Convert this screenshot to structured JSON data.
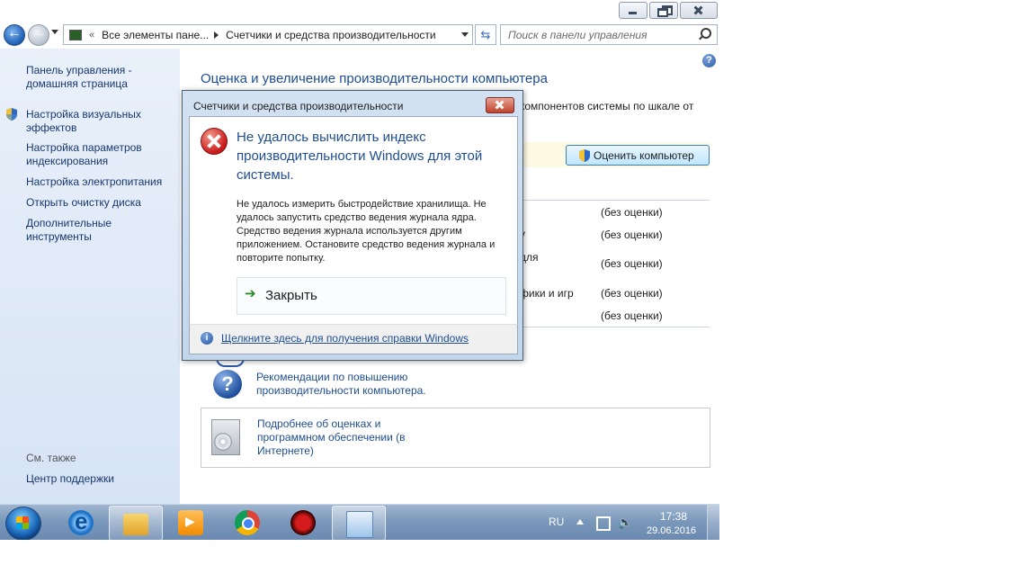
{
  "address": {
    "chevron": "«",
    "part1": "Все элементы пане...",
    "part2": "Счетчики и средства производительности"
  },
  "search": {
    "placeholder": "Поиск в панели управления"
  },
  "sidebar": {
    "items": [
      {
        "label": "Панель управления - домашняя страница"
      },
      {
        "label": "Настройка визуальных эффектов"
      },
      {
        "label": "Настройка параметров индексирования"
      },
      {
        "label": "Настройка электропитания"
      },
      {
        "label": "Открыть очистку диска"
      },
      {
        "label": "Дополнительные инструменты"
      }
    ],
    "see_also": "См. также",
    "support": "Центр поддержки"
  },
  "main": {
    "title": "Оценка и увеличение производительности компьютера",
    "bg_description": "компонентов системы по шкале от",
    "rate_button": "Оценить компьютер",
    "fragments": [
      "у",
      "для",
      "фики и игр"
    ],
    "scores": [
      "(без оценки)",
      "(без оценки)",
      "(без оценки)",
      "(без оценки)",
      "(без оценки)"
    ],
    "recommendations": "Рекомендации по повышению производительности компьютера.",
    "details": "Подробнее об оценках и программном обеспечении (в Интернете)"
  },
  "dialog": {
    "title": "Счетчики и средства производительности",
    "heading": "Не удалось вычислить индекс производительности Windows для этой системы.",
    "message": "Не удалось измерить быстродействие хранилища. Не удалось запустить средство ведения журнала ядра. Средство ведения журнала используется другим приложением. Остановите средство ведения журнала и повторите попытку.",
    "close_label": "Закрыть",
    "help_link": "Щелкните здесь для получения справки Windows"
  },
  "taskbar": {
    "lang": "RU",
    "time": "17:38",
    "date": "29.06.2016"
  },
  "colors": {
    "link": "#1f4d90",
    "sidebar_link": "#16386e",
    "taskbar": "#7b98bb",
    "error_red": "#c8191b"
  }
}
